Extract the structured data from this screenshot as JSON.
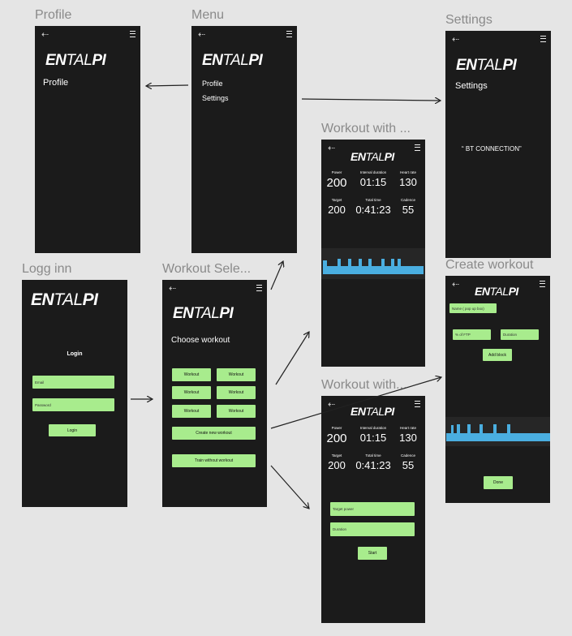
{
  "frames": {
    "profile": {
      "label": "Profile",
      "item": "Profile"
    },
    "menu": {
      "label": "Menu",
      "items": [
        "Profile",
        "Settings"
      ]
    },
    "settings": {
      "label": "Settings",
      "title": "Settings",
      "bt": "“ BT CONNECTION”"
    },
    "login": {
      "label": "Logg inn",
      "title": "Login",
      "email": "Email",
      "password": "Password",
      "button": "Login"
    },
    "workout_select": {
      "label": "Workout Sele...",
      "heading": "Choose workout",
      "workouts": [
        "Workout",
        "Workout",
        "Workout",
        "Workout",
        "Workout",
        "Workout"
      ],
      "create": "Create new workout",
      "train": "Train without workout"
    },
    "workout_with1": {
      "label": "Workout with ..."
    },
    "workout_with2": {
      "label": "Workout with...",
      "target_power": "Target power",
      "duration": "Duration",
      "start": "Start"
    },
    "create_workout": {
      "label": "Create workout",
      "name": "Name ( pop up box)",
      "ftp": "% of FTP",
      "duration": "Duration",
      "add_block": "Add block",
      "done": "Done"
    }
  },
  "brand": {
    "bold1": "EN",
    "light": "TAL",
    "bold2": "PI"
  },
  "stats": {
    "power_label": "Power",
    "power": "200",
    "interval_label": "Interval duration",
    "interval": "01:15",
    "hr_label": "Heart rate",
    "hr": "130",
    "target_label": "Target",
    "target": "200",
    "total_label": "Total time",
    "total": "0:41:23",
    "cadence_label": "Cadence",
    "cadence": "55"
  },
  "colors": {
    "bg": "#e5e5e5",
    "frame": "#1b1b1b",
    "accent": "#a8ec8d",
    "chart": "#4aaee0"
  }
}
